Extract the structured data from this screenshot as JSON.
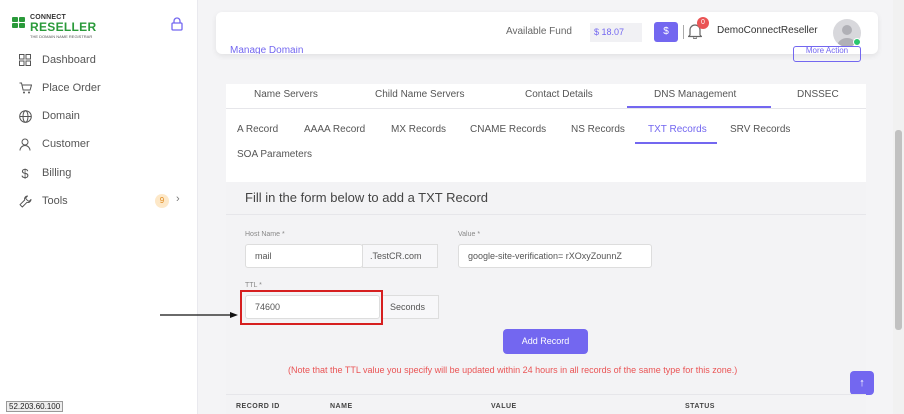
{
  "brand": {
    "line1": "CONNECT",
    "line2": "RESELLER",
    "tagline": "THE DOMAIN NAME REGISTRAR"
  },
  "sidebar": {
    "items": [
      {
        "label": "Dashboard",
        "icon": "grid-icon"
      },
      {
        "label": "Place Order",
        "icon": "cart-icon"
      },
      {
        "label": "Domain",
        "icon": "globe-icon"
      },
      {
        "label": "Customer",
        "icon": "user-icon"
      },
      {
        "label": "Billing",
        "icon": "dollar-icon"
      },
      {
        "label": "Tools",
        "icon": "wrench-icon",
        "badge": "9"
      }
    ]
  },
  "topbar": {
    "fund_label": "Available Fund",
    "fund_value": "$ 18.07",
    "dollar_button": "$",
    "notification_count": "0",
    "username": "DemoConnectReseller"
  },
  "header": {
    "manage_domain": "Manage Domain",
    "more_action": "More Action"
  },
  "tabs": [
    {
      "label": "Name Servers"
    },
    {
      "label": "Child Name Servers"
    },
    {
      "label": "Contact Details"
    },
    {
      "label": "DNS Management",
      "active": true
    },
    {
      "label": "DNSSEC"
    }
  ],
  "subtabs": [
    {
      "label": "A Record"
    },
    {
      "label": "AAAA Record"
    },
    {
      "label": "MX Records"
    },
    {
      "label": "CNAME Records"
    },
    {
      "label": "NS Records"
    },
    {
      "label": "TXT Records",
      "active": true
    },
    {
      "label": "SRV Records"
    },
    {
      "label": "SOA Parameters"
    }
  ],
  "form": {
    "title": "Fill in the form below to add a TXT Record",
    "host_label": "Host Name *",
    "host_value": "mail",
    "host_suffix": ".TestCR.com",
    "value_label": "Value *",
    "value_value": "google-site-verification= rXOxyZounnZ",
    "ttl_label": "TTL *",
    "ttl_value": "74600",
    "ttl_unit": "Seconds",
    "submit": "Add Record",
    "note": "(Note that the TTL value you specify will be updated within 24 hours in all records of the same type for this zone.)"
  },
  "table": {
    "columns": [
      "RECORD ID",
      "NAME",
      "VALUE",
      "STATUS"
    ]
  },
  "status_ip": "52.203.60.100",
  "colors": {
    "accent": "#7367f0",
    "brand_green": "#2a9a3a",
    "danger": "#ea5455",
    "highlight_box": "#d61f1f"
  }
}
